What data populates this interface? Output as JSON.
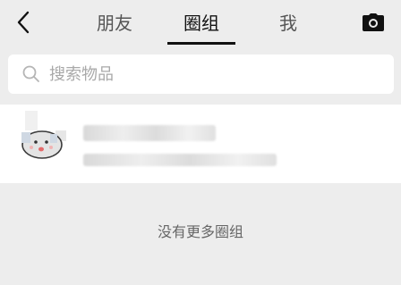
{
  "nav": {
    "tabs": [
      {
        "label": "朋友",
        "active": false
      },
      {
        "label": "圈组",
        "active": true
      },
      {
        "label": "我",
        "active": false
      }
    ]
  },
  "search": {
    "placeholder": "搜索物品",
    "value": ""
  },
  "list": {
    "end_text": "没有更多圈组"
  },
  "colors": {
    "background": "#ededed",
    "surface": "#ffffff",
    "text": "#111111",
    "muted": "#a9a9a9"
  }
}
